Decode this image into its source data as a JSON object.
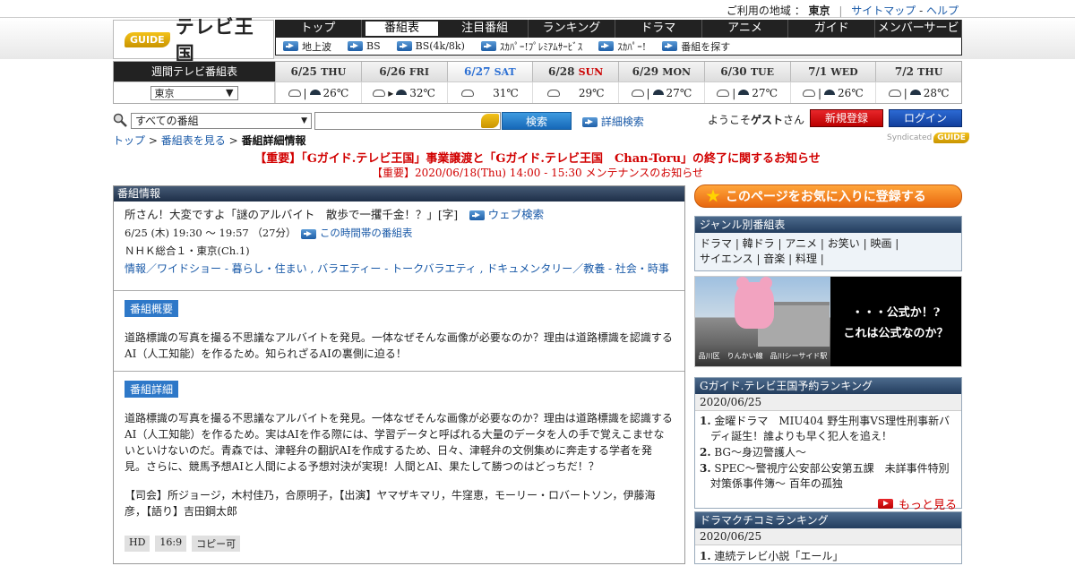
{
  "topbar": {
    "region_label": "ご利用の地域 ：",
    "region": "東京",
    "sitemap": "サイトマップ",
    "dash": "-",
    "help": "ヘルプ"
  },
  "logo": {
    "badge": "GUIDE",
    "text": "テレビ王国"
  },
  "nav": [
    "トップ",
    "番組表",
    "注目番組",
    "ランキング",
    "ドラマ",
    "アニメ",
    "ガイド",
    "メンバーサービス"
  ],
  "subnav": [
    "地上波",
    "BS",
    "BS(4k/8k)",
    "ｽｶﾊﾟｰ!ﾌﾟﾚﾐｱﾑｻｰﾋﾞｽ",
    "ｽｶﾊﾟｰ!",
    "番組を探す"
  ],
  "days": {
    "weekly_label": "週間テレビ番組表",
    "region_select": "東京",
    "list": [
      {
        "date": "6/25",
        "dow": "THU",
        "weather": "26℃"
      },
      {
        "date": "6/26",
        "dow": "FRI",
        "weather": "32℃"
      },
      {
        "date": "6/27",
        "dow": "SAT",
        "weather": "31℃"
      },
      {
        "date": "6/28",
        "dow": "SUN",
        "weather": "29℃"
      },
      {
        "date": "6/29",
        "dow": "MON",
        "weather": "27℃"
      },
      {
        "date": "6/30",
        "dow": "TUE",
        "weather": "27℃"
      },
      {
        "date": "7/1",
        "dow": "WED",
        "weather": "26℃"
      },
      {
        "date": "7/2",
        "dow": "THU",
        "weather": "28℃"
      }
    ]
  },
  "search": {
    "category": "すべての番組",
    "placeholder": "",
    "button": "検索",
    "advanced": "詳細検索"
  },
  "user": {
    "welcome_prefix": "ようこそ",
    "welcome_name": "ゲスト",
    "welcome_suffix": "さん",
    "register": "新規登録",
    "login": "ログイン"
  },
  "breadcrumb": {
    "top": "トップ",
    "schedule": "番組表を見る",
    "current": "番組詳細情報",
    "sep": ">"
  },
  "syndicated": {
    "label": "Syndicated",
    "badge": "GUIDE"
  },
  "notices": [
    "【重要】「Gガイド.テレビ王国」事業譲渡と「Gガイド.テレビ王国　Chan-Toru」の終了に関するお知らせ",
    "【重要】2020/06/18(Thu) 14:00 - 15:30 メンテナンスのお知らせ"
  ],
  "program": {
    "header": "番組情報",
    "title": "所さん！大変ですよ「謎のアルバイト　散歩で一攫千金！？」[字]",
    "web_search": "ウェブ検索",
    "time": "6/25 (木) 19:30 ～ 19:57 （27分）",
    "timeslot_link": "この時間帯の番組表",
    "channel": "ＮＨＫ総合１・東京(Ch.1)",
    "genres": "情報／ワイドショー - 暮らし・住まい , バラエティー - トークバラエティ , ドキュメンタリー／教養 - 社会・時事",
    "summary_tag": "番組概要",
    "summary": "道路標識の写真を撮る不思議なアルバイトを発見。一体なぜそんな画像が必要なのか？理由は道路標識を認識するAI（人工知能）を作るため。知られざるAIの裏側に迫る！",
    "detail_tag": "番組詳細",
    "detail": "道路標識の写真を撮る不思議なアルバイトを発見。一体なぜそんな画像が必要なのか？理由は道路標識を認識するAI（人工知能）を作るため。実はAIを作る際には、学習データと呼ばれる大量のデータを人の手で覚えこませないといけないのだ。青森では、津軽弁の翻訳AIを作成するため、日々、津軽弁の文例集めに奔走する学者を発見。さらに、競馬予想AIと人間による予想対決が実現！人間とAI、果たして勝つのはどっちだ！？",
    "cast": "【司会】所ジョージ，木村佳乃，合原明子，【出演】ヤマザキマリ，牛窪恵，モーリー・ロバートソン，伊藤海彦，【語り】吉田鋼太郎",
    "chips": [
      "HD",
      "16:9",
      "コピー可"
    ]
  },
  "sidebar": {
    "favorite": "このページをお気に入りに登録する",
    "genre_header": "ジャンル別番組表",
    "genre_line1": "ドラマ | 韓ドラ | アニメ | お笑い | 映画 |",
    "genre_line2": "サイエンス | 音楽 | 料理 |",
    "banner_line1": "・・・公式か！?",
    "banner_line2": "これは公式なのか？",
    "banner_caption": "品川区　りんかい線　品川シーサイド駅",
    "ranking_header": "Gガイド.テレビ王国予約ランキング",
    "ranking_date": "2020/06/25",
    "ranking": [
      {
        "n": "1.",
        "t": "金曜ドラマ　MIU404 野生刑事VS理性刑事新バディ誕生！誰よりも早く犯人を追え！"
      },
      {
        "n": "2.",
        "t": "BG～身辺警護人～"
      },
      {
        "n": "3.",
        "t": "SPEC～警視庁公安部公安第五課　未詳事件特別対策係事件簿～ 百年の孤独"
      }
    ],
    "more": "もっと見る",
    "drama_header": "ドラマクチコミランキング",
    "drama_date": "2020/06/25",
    "drama_first_n": "1.",
    "drama_first": "連続テレビ小説「エール」"
  }
}
